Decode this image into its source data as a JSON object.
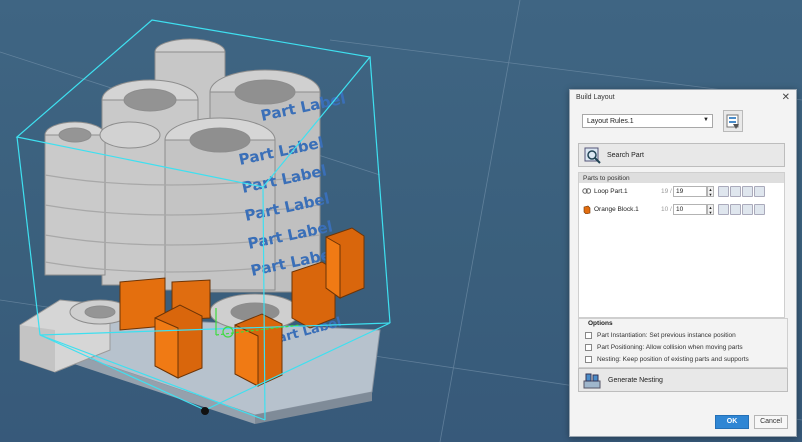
{
  "dialog": {
    "title": "Build Layout",
    "close_glyph": "✕",
    "layout_rules": {
      "selected": "Layout Rules.1"
    },
    "search_part": {
      "label": "Search Part",
      "icon": "search-part-icon"
    },
    "parts_to_position": {
      "header": "Parts to position",
      "rows": [
        {
          "name": "Loop Part.1",
          "max": "19 /",
          "value": "19",
          "icon": "loop-part-icon"
        },
        {
          "name": "Orange Block.1",
          "max": "10 /",
          "value": "10",
          "icon": "orange-block-icon"
        }
      ]
    },
    "options": {
      "title": "Options",
      "items": [
        {
          "label": "Part Instantiation: Set previous instance position",
          "checked": false
        },
        {
          "label": "Part Positioning: Allow collision when moving parts",
          "checked": false
        },
        {
          "label": "Nesting: Keep position of existing parts and supports",
          "checked": false
        }
      ]
    },
    "generate": {
      "label": "Generate Nesting",
      "icon": "generate-nesting-icon"
    },
    "ok_label": "OK",
    "cancel_label": "Cancel"
  },
  "scene": {
    "part_label_text": "Part Label",
    "background_color": "#3d627f",
    "bounding_box_color": "#3ee0f0",
    "orange_block_color": "#e8700f",
    "loop_part_color": "#c9c9c9"
  }
}
